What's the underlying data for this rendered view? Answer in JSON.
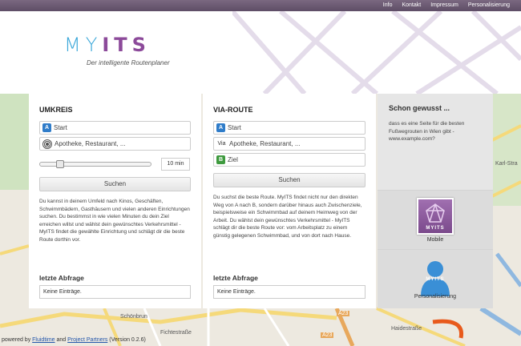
{
  "nav": {
    "items": [
      "Info",
      "Kontakt",
      "Impressum",
      "Personalisierung"
    ]
  },
  "logo": {
    "my": "MY",
    "its": "ITS",
    "tagline": "Der intelligente Routenplaner"
  },
  "umkreis": {
    "title": "UMKREIS",
    "start": "Start",
    "poi_placeholder": "Apotheke, Restaurant, ...",
    "slider_value": 0.15,
    "minutes": "10 min",
    "search_label": "Suchen",
    "description": "Du kannst in deinem Umfeld nach Kinos, Geschäften, Schwimmbädern, Gasthäusern und vielen anderen Einrichtungen suchen. Du bestimmst in wie vielen Minuten du dein Ziel erreichen willst und wählst dein gewünschtes Verkehrsmittel - MyITS findet die gewählte Einrichtung und schlägt dir die beste Route dorthin vor.",
    "last_title": "letzte Abfrage",
    "last_value": "Keine Einträge."
  },
  "via": {
    "title": "VIA-ROUTE",
    "badge_a": "A",
    "start": "Start",
    "via_label": "Via",
    "poi_placeholder": "Apotheke, Restaurant, ...",
    "badge_b": "B",
    "target": "Ziel",
    "search_label": "Suchen",
    "description": "Du suchst die beste Route. MyITS findet nicht nur den direkten Weg von A nach B, sondern darüber hinaus auch Zwischenziele, beispielsweise ein Schwimmbad auf deinem Heimweg von der Arbeit. Du wählst dein gewünschtes Verkehrsmittel - MyITS schlägt dir die beste Route vor: vom Arbeitsplatz zu einem günstig gelegenen Schwimmbad, und von dort nach Hause.",
    "last_title": "letzte Abfrage",
    "last_value": "Keine Einträge."
  },
  "tip": {
    "title": "Schon gewusst ...",
    "text": "dass es eine Seite für die besten Fußwegrouten in Wien gibt - www.example.com?"
  },
  "tiles": {
    "mobile_label": "Mobile",
    "mobile_logo": "MYITS",
    "person_label": "Personalisierung",
    "person_logo": "MYITS"
  },
  "footer": {
    "prefix": "powered by",
    "link1": "Fluidtime",
    "and": "and",
    "link2": "Project Partners",
    "version": "(Version 0.2.6)"
  },
  "map_labels": {
    "l1": "Schönbrun",
    "l2": "Fichtestraße",
    "l3": "A23",
    "l4": "Haidestraße",
    "l5": "A23",
    "l6": "Karl-Stra"
  },
  "colors": {
    "topbar": "#6b5874",
    "logo_my": "#3aa7d9",
    "logo_its": "#8c4a9a",
    "badge_a": "#2f7cc9",
    "badge_b": "#3e9a3e"
  }
}
